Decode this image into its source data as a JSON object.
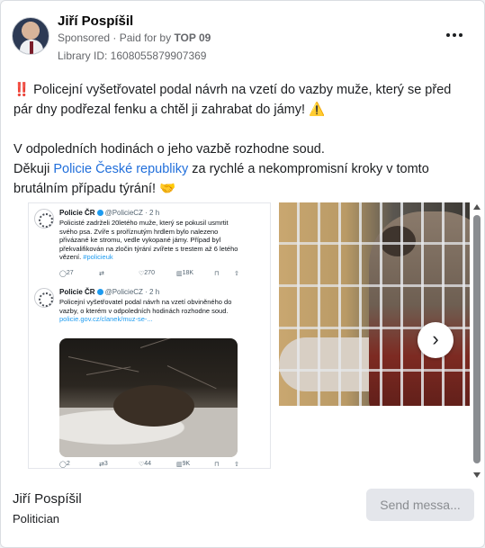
{
  "post": {
    "author": "Jiří Pospíšil",
    "sponsored_label": "Sponsored",
    "paid_for_prefix": "· Paid for by",
    "paid_for_by": "TOP 09",
    "library_id": "Library ID: 1608055879907369",
    "text_line1_emoji": "‼️",
    "text_line1": "Policejní vyšetřovatel podal návrh na vzetí do vazby muže, který se před pár dny podřezal fenku a chtěl ji zahrabat do jámy!",
    "text_line1_end_emoji": "⚠️",
    "text_line2": "V odpoledních hodinách o jeho vazbě rozhodne soud.",
    "text_line3_pre": "Děkuji",
    "text_line3_link": "Policie České republiky",
    "text_line3_post": "za rychlé a nekompromisní kroky v tomto brutálním případu týrání!",
    "text_line3_emoji": "🤝"
  },
  "carousel": {
    "tweet1": {
      "account": "Policie ČR",
      "handle_time": "@PolicieCZ · 2 h",
      "text": "Policisté zadrželi 20letého muže, který se pokusil usmrtit svého psa. Zvíře s proříznutým hrdlem bylo nalezeno přivázané ke stromu, vedle vykopané jámy. Případ byl překvalifikován na zločin týrání zvířete s trestem až 6 letého vězení.",
      "hashtag": "#policieuk",
      "replies": "27",
      "reposts": "",
      "likes": "270",
      "views": "18K"
    },
    "tweet2": {
      "account": "Policie ČR",
      "handle_time": "@PolicieCZ · 2 h",
      "text": "Policejní vyšetřovatel podal návrh na vzetí obviněného do vazby, o kterém v odpoledních hodinách rozhodne soud.",
      "link": "policie.gov.cz/clanek/muz-se-...",
      "replies": "2",
      "reposts": "3",
      "likes": "44",
      "views": "9K"
    },
    "next_icon": "›"
  },
  "footer": {
    "name": "Jiří Pospíšil",
    "role": "Politician",
    "send_label": "Send messa..."
  }
}
